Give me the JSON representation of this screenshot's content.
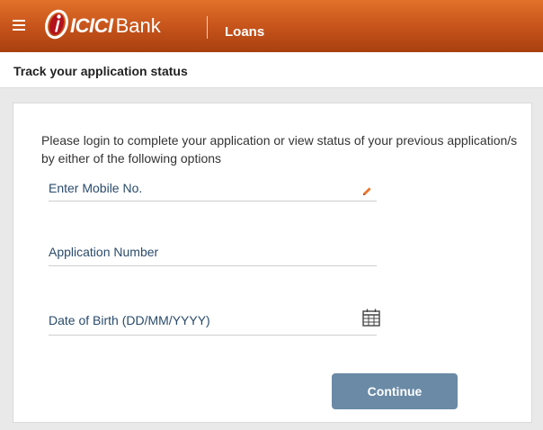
{
  "header": {
    "logo": {
      "brand": "ICICI",
      "suffix": "Bank"
    },
    "section_title": "Loans",
    "brand_color": "#c4521a"
  },
  "subheader": {
    "title": "Track your application status"
  },
  "form": {
    "intro": "Please login to complete your application or view status of your previous application/s by either of the following options",
    "fields": [
      {
        "label": "Enter Mobile No.",
        "value": "",
        "icon": "pencil-icon"
      },
      {
        "label": "Application Number",
        "value": ""
      },
      {
        "label": "Date of Birth (DD/MM/YYYY)",
        "value": "",
        "icon": "calendar-icon"
      }
    ],
    "submit_label": "Continue",
    "submit_color": "#6a8aa6"
  }
}
